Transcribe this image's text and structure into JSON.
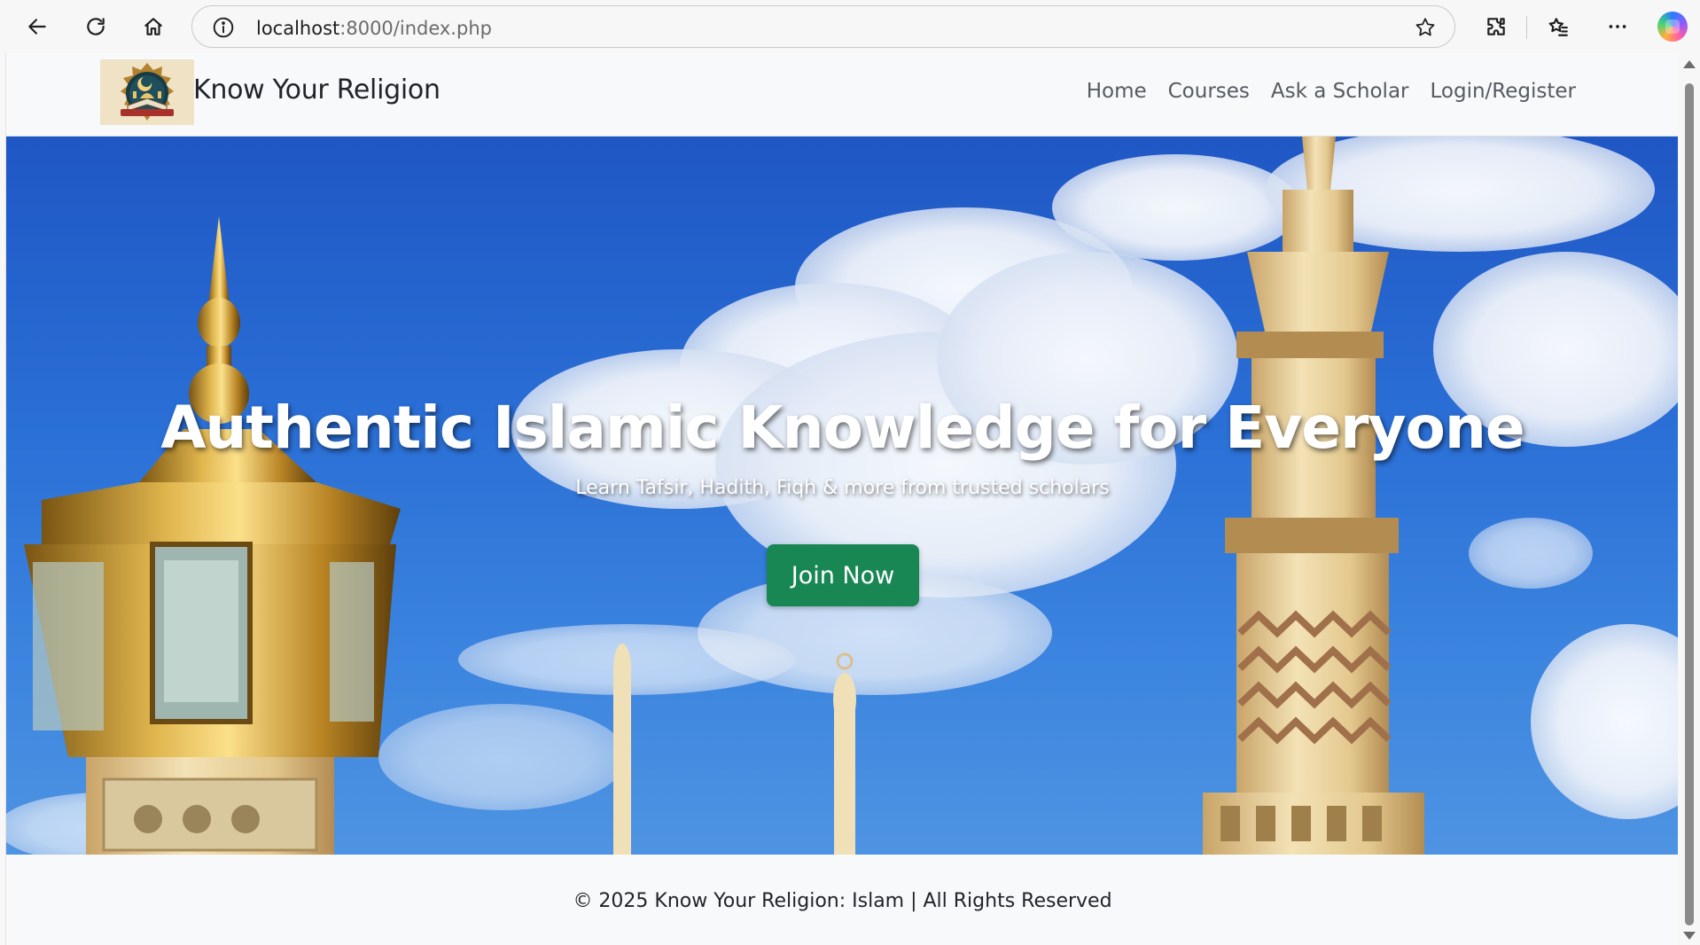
{
  "browser": {
    "url_host": "localhost",
    "url_path": ":8000/index.php",
    "icons": [
      "back-icon",
      "reload-icon",
      "home-icon",
      "info-icon",
      "favorite-star-icon",
      "extensions-icon",
      "favorites-icon",
      "more-icon",
      "copilot-icon"
    ]
  },
  "site": {
    "brand": "Know Your Religion",
    "nav": [
      {
        "label": "Home"
      },
      {
        "label": "Courses"
      },
      {
        "label": "Ask a Scholar"
      },
      {
        "label": "Login/Register"
      }
    ]
  },
  "hero": {
    "title": "Authentic Islamic Knowledge for Everyone",
    "subtitle": "Learn Tafsir, Hadith, Fiqh & more from trusted scholars",
    "cta_label": "Join Now"
  },
  "footer": {
    "text": "© 2025 Know Your Religion: Islam | All Rights Reserved"
  },
  "colors": {
    "primary_button": "#198754",
    "navbar_bg": "#f8f9fa",
    "sky": "#2a6fd6"
  }
}
